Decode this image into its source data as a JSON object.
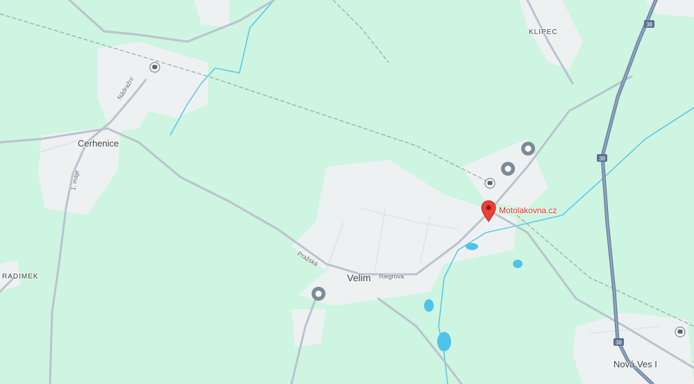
{
  "map": {
    "towns": [
      {
        "name": "Cerhenice"
      },
      {
        "name": "Velim"
      },
      {
        "name": "Nová Ves I"
      }
    ],
    "villages": [
      {
        "name": "KLIPEC"
      },
      {
        "name": "RADIMEK"
      }
    ],
    "streets": [
      {
        "name": "Nádražní"
      },
      {
        "name": "1. máje"
      },
      {
        "name": "Pražská"
      },
      {
        "name": "Riegrova"
      }
    ],
    "highway_shields": [
      "38",
      "38",
      "38"
    ],
    "place_marker": {
      "name": "Motolakovna.cz",
      "icon": "red-pin-icon",
      "color": "#ea4335"
    },
    "poi_markers": [
      "poi-pin-icon",
      "poi-pin-icon",
      "poi-pin-icon"
    ],
    "transit_icons": [
      "train-station-icon",
      "train-station-icon",
      "train-station-icon"
    ],
    "colors": {
      "land": "#cdf5e1",
      "built_up": "#eef1f2",
      "road": "#b9c3cd",
      "highway": "#7f93b3",
      "water": "#4fc3e8",
      "rail": "#9aa3ab"
    }
  }
}
